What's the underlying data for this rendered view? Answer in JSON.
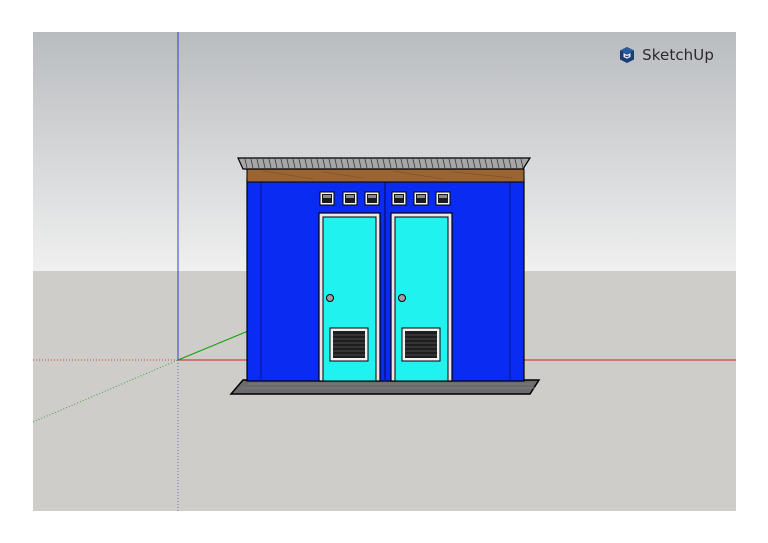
{
  "app": {
    "brand_name": "SketchUp",
    "brand_icon": "sketchup-logo-icon"
  },
  "scene": {
    "colors": {
      "sky_top": "#b9bcbf",
      "sky_bottom": "#f0f0f0",
      "ground": "#cfcdc9",
      "wall": "#0a2bf2",
      "wall_trim": "#081fb8",
      "door": "#20f2f0",
      "door_frame": "#e8e8e8",
      "roof_beam": "#9a6433",
      "roof_sheet": "#a6a6a6",
      "floor_slab": "#6b6b6b",
      "vent": "#2a2a2a",
      "axis_red": "#d00000",
      "axis_green": "#00a000",
      "axis_blue": "#2020c0"
    },
    "objects": [
      "toilet-building-model",
      "roof-sheet",
      "roof-beam",
      "left-door",
      "right-door",
      "transom-windows",
      "floor-slab",
      "axes"
    ]
  }
}
